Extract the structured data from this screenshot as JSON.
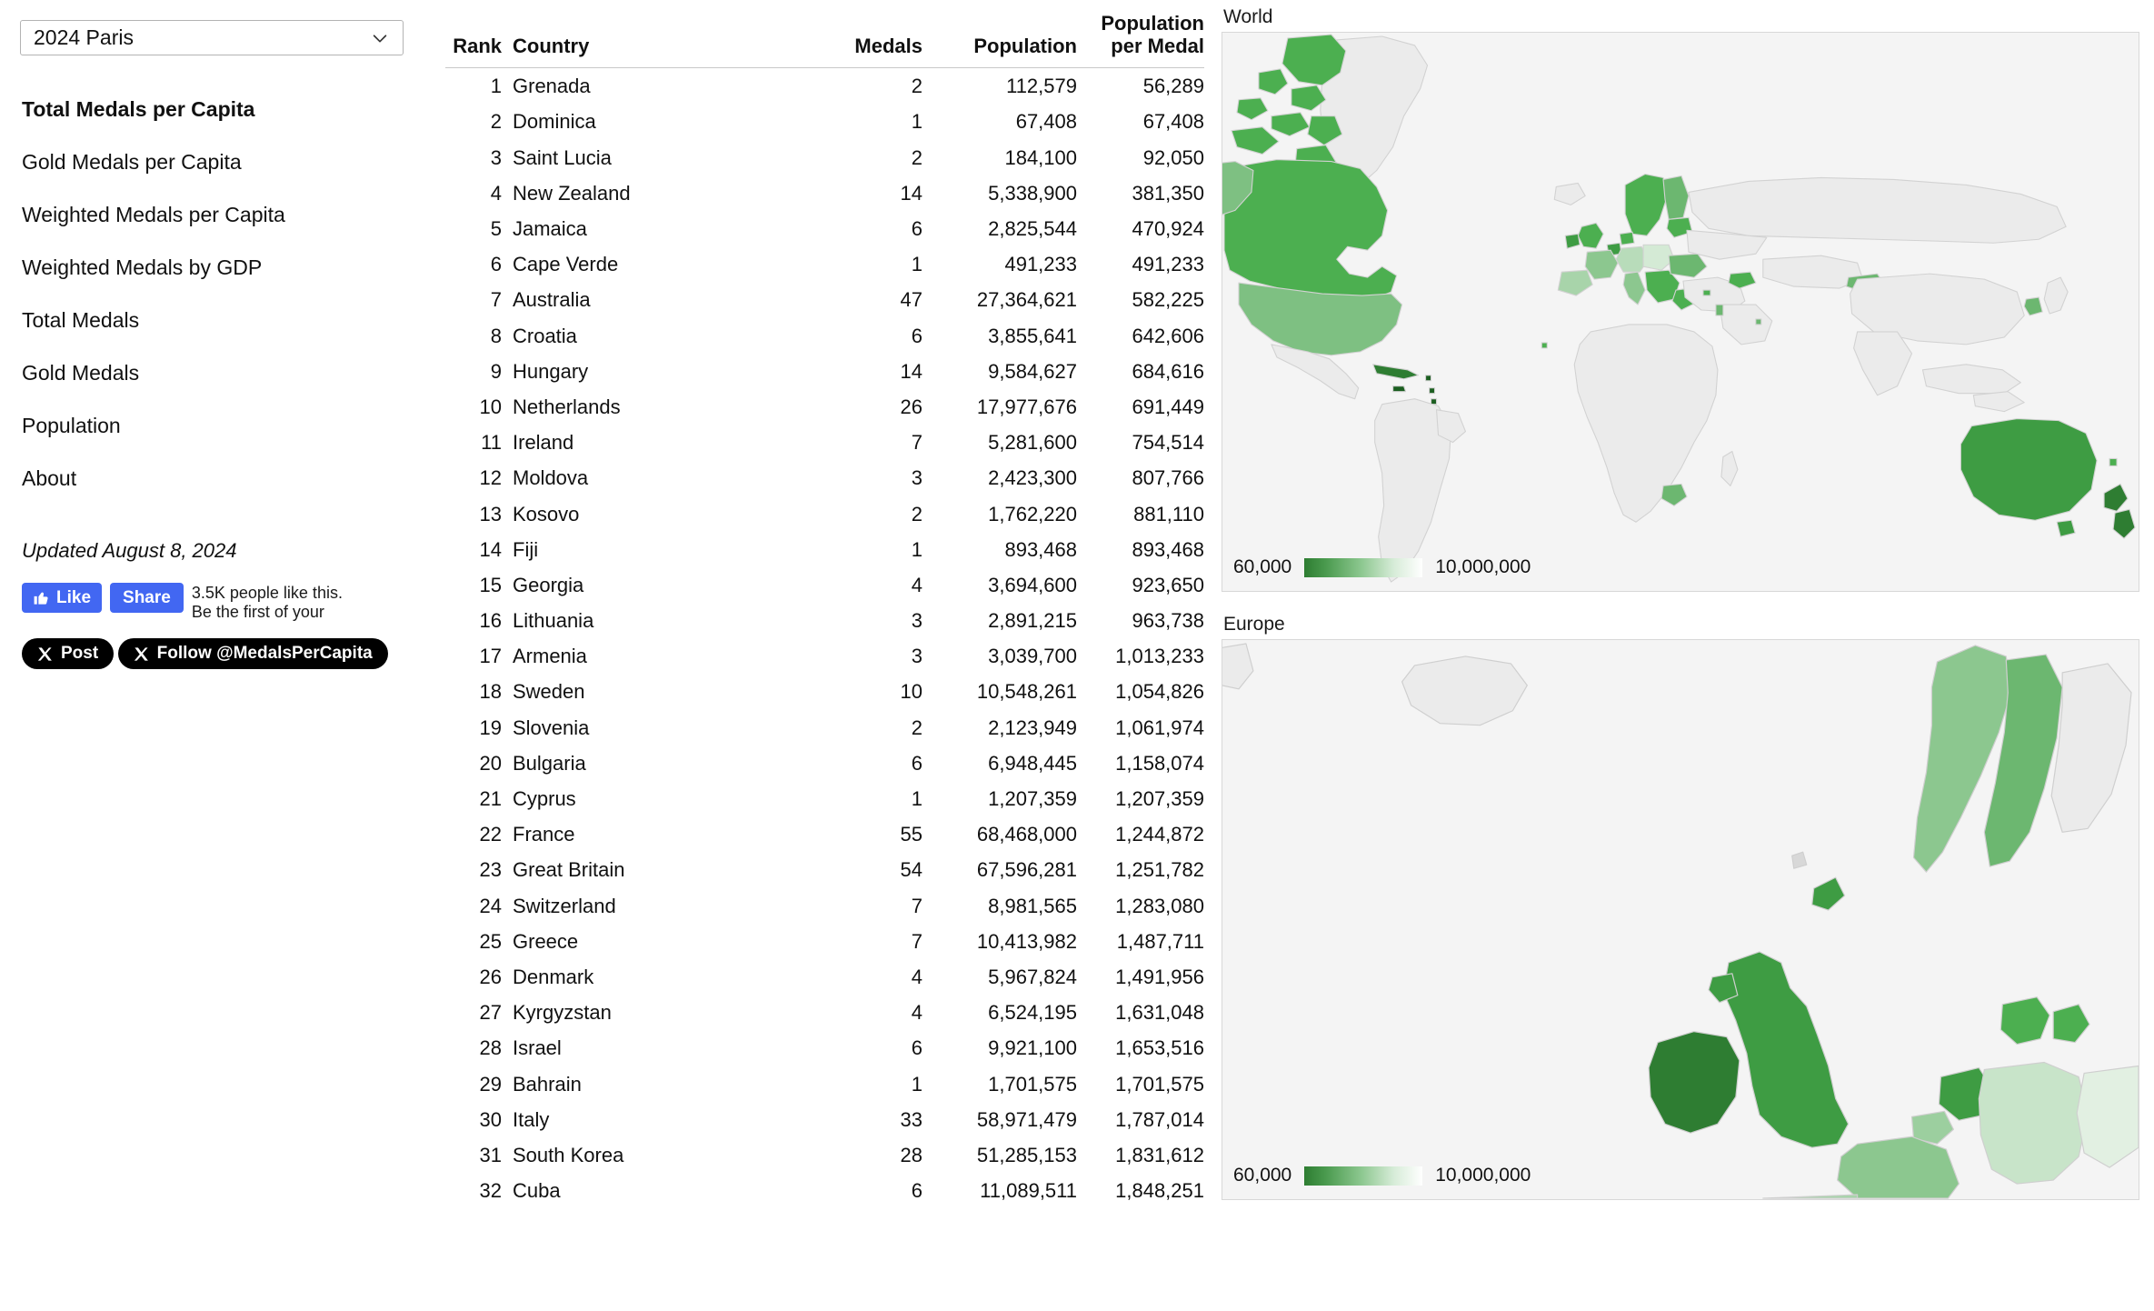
{
  "sidebar": {
    "games_select": {
      "value": "2024 Paris",
      "icon": "chevron-down-icon"
    },
    "nav_items": [
      {
        "label": "Total Medals per Capita",
        "active": true
      },
      {
        "label": "Gold Medals per Capita",
        "active": false
      },
      {
        "label": "Weighted Medals per Capita",
        "active": false
      },
      {
        "label": "Weighted Medals by GDP",
        "active": false
      },
      {
        "label": "Total Medals",
        "active": false
      },
      {
        "label": "Gold Medals",
        "active": false
      },
      {
        "label": "Population",
        "active": false
      },
      {
        "label": "About",
        "active": false
      }
    ],
    "updated": "Updated August 8, 2024",
    "facebook": {
      "like_label": "Like",
      "share_label": "Share",
      "like_icon": "thumbs-up-icon",
      "caption_line1": "3.5K people like this.",
      "caption_line2": "Be the first of your",
      "brand_color": "#4267f2"
    },
    "x_post": {
      "label": "Post",
      "icon": "x-logo-icon"
    },
    "x_follow": {
      "label": "Follow @MedalsPerCapita",
      "icon": "x-logo-icon"
    }
  },
  "table": {
    "columns": [
      "Rank",
      "Country",
      "Medals",
      "Population",
      "Population per Medal"
    ],
    "column_header_ppm_line1": "Population",
    "column_header_ppm_line2": "per Medal",
    "rows": [
      {
        "rank": "1",
        "country": "Grenada",
        "medals": "2",
        "population": "112,579",
        "per_medal": "56,289"
      },
      {
        "rank": "2",
        "country": "Dominica",
        "medals": "1",
        "population": "67,408",
        "per_medal": "67,408"
      },
      {
        "rank": "3",
        "country": "Saint Lucia",
        "medals": "2",
        "population": "184,100",
        "per_medal": "92,050"
      },
      {
        "rank": "4",
        "country": "New Zealand",
        "medals": "14",
        "population": "5,338,900",
        "per_medal": "381,350"
      },
      {
        "rank": "5",
        "country": "Jamaica",
        "medals": "6",
        "population": "2,825,544",
        "per_medal": "470,924"
      },
      {
        "rank": "6",
        "country": "Cape Verde",
        "medals": "1",
        "population": "491,233",
        "per_medal": "491,233"
      },
      {
        "rank": "7",
        "country": "Australia",
        "medals": "47",
        "population": "27,364,621",
        "per_medal": "582,225"
      },
      {
        "rank": "8",
        "country": "Croatia",
        "medals": "6",
        "population": "3,855,641",
        "per_medal": "642,606"
      },
      {
        "rank": "9",
        "country": "Hungary",
        "medals": "14",
        "population": "9,584,627",
        "per_medal": "684,616"
      },
      {
        "rank": "10",
        "country": "Netherlands",
        "medals": "26",
        "population": "17,977,676",
        "per_medal": "691,449"
      },
      {
        "rank": "11",
        "country": "Ireland",
        "medals": "7",
        "population": "5,281,600",
        "per_medal": "754,514"
      },
      {
        "rank": "12",
        "country": "Moldova",
        "medals": "3",
        "population": "2,423,300",
        "per_medal": "807,766"
      },
      {
        "rank": "13",
        "country": "Kosovo",
        "medals": "2",
        "population": "1,762,220",
        "per_medal": "881,110"
      },
      {
        "rank": "14",
        "country": "Fiji",
        "medals": "1",
        "population": "893,468",
        "per_medal": "893,468"
      },
      {
        "rank": "15",
        "country": "Georgia",
        "medals": "4",
        "population": "3,694,600",
        "per_medal": "923,650"
      },
      {
        "rank": "16",
        "country": "Lithuania",
        "medals": "3",
        "population": "2,891,215",
        "per_medal": "963,738"
      },
      {
        "rank": "17",
        "country": "Armenia",
        "medals": "3",
        "population": "3,039,700",
        "per_medal": "1,013,233"
      },
      {
        "rank": "18",
        "country": "Sweden",
        "medals": "10",
        "population": "10,548,261",
        "per_medal": "1,054,826"
      },
      {
        "rank": "19",
        "country": "Slovenia",
        "medals": "2",
        "population": "2,123,949",
        "per_medal": "1,061,974"
      },
      {
        "rank": "20",
        "country": "Bulgaria",
        "medals": "6",
        "population": "6,948,445",
        "per_medal": "1,158,074"
      },
      {
        "rank": "21",
        "country": "Cyprus",
        "medals": "1",
        "population": "1,207,359",
        "per_medal": "1,207,359"
      },
      {
        "rank": "22",
        "country": "France",
        "medals": "55",
        "population": "68,468,000",
        "per_medal": "1,244,872"
      },
      {
        "rank": "23",
        "country": "Great Britain",
        "medals": "54",
        "population": "67,596,281",
        "per_medal": "1,251,782"
      },
      {
        "rank": "24",
        "country": "Switzerland",
        "medals": "7",
        "population": "8,981,565",
        "per_medal": "1,283,080"
      },
      {
        "rank": "25",
        "country": "Greece",
        "medals": "7",
        "population": "10,413,982",
        "per_medal": "1,487,711"
      },
      {
        "rank": "26",
        "country": "Denmark",
        "medals": "4",
        "population": "5,967,824",
        "per_medal": "1,491,956"
      },
      {
        "rank": "27",
        "country": "Kyrgyzstan",
        "medals": "4",
        "population": "6,524,195",
        "per_medal": "1,631,048"
      },
      {
        "rank": "28",
        "country": "Israel",
        "medals": "6",
        "population": "9,921,100",
        "per_medal": "1,653,516"
      },
      {
        "rank": "29",
        "country": "Bahrain",
        "medals": "1",
        "population": "1,701,575",
        "per_medal": "1,701,575"
      },
      {
        "rank": "30",
        "country": "Italy",
        "medals": "33",
        "population": "58,971,479",
        "per_medal": "1,787,014"
      },
      {
        "rank": "31",
        "country": "South Korea",
        "medals": "28",
        "population": "51,285,153",
        "per_medal": "1,831,612"
      },
      {
        "rank": "32",
        "country": "Cuba",
        "medals": "6",
        "population": "11,089,511",
        "per_medal": "1,848,251"
      }
    ]
  },
  "maps": {
    "world": {
      "title": "World",
      "legend_min": "60,000",
      "legend_max": "10,000,000",
      "color_dark": "#2e7d32",
      "color_light": "#ffffff",
      "color_nodata": "#ebebeb"
    },
    "europe": {
      "title": "Europe",
      "legend_min": "60,000",
      "legend_max": "10,000,000",
      "color_dark": "#2e7d32",
      "color_light": "#ffffff",
      "color_nodata": "#ebebeb"
    }
  },
  "chart_data": {
    "type": "table",
    "title": "Total Medals per Capita — 2024 Paris",
    "columns": [
      "Rank",
      "Country",
      "Medals",
      "Population",
      "Population per Medal"
    ],
    "categories": [
      "Grenada",
      "Dominica",
      "Saint Lucia",
      "New Zealand",
      "Jamaica",
      "Cape Verde",
      "Australia",
      "Croatia",
      "Hungary",
      "Netherlands",
      "Ireland",
      "Moldova",
      "Kosovo",
      "Fiji",
      "Georgia",
      "Lithuania",
      "Armenia",
      "Sweden",
      "Slovenia",
      "Bulgaria",
      "Cyprus",
      "France",
      "Great Britain",
      "Switzerland",
      "Greece",
      "Denmark",
      "Kyrgyzstan",
      "Israel",
      "Bahrain",
      "Italy",
      "South Korea",
      "Cuba"
    ],
    "series": [
      {
        "name": "Medals",
        "values": [
          2,
          1,
          2,
          14,
          6,
          1,
          47,
          6,
          14,
          26,
          7,
          3,
          2,
          1,
          4,
          3,
          3,
          10,
          2,
          6,
          1,
          55,
          54,
          7,
          7,
          4,
          4,
          6,
          1,
          33,
          28,
          6
        ]
      },
      {
        "name": "Population",
        "values": [
          112579,
          67408,
          184100,
          5338900,
          2825544,
          491233,
          27364621,
          3855641,
          9584627,
          17977676,
          5281600,
          2423300,
          1762220,
          893468,
          3694600,
          2891215,
          3039700,
          10548261,
          2123949,
          6948445,
          1207359,
          68468000,
          67596281,
          8981565,
          10413982,
          5967824,
          6524195,
          9921100,
          1701575,
          58971479,
          51285153,
          11089511
        ]
      },
      {
        "name": "Population per Medal",
        "values": [
          56289,
          67408,
          92050,
          381350,
          470924,
          491233,
          582225,
          642606,
          684616,
          691449,
          754514,
          807766,
          881110,
          893468,
          923650,
          963738,
          1013233,
          1054826,
          1061974,
          1158074,
          1207359,
          1244872,
          1251782,
          1283080,
          1487711,
          1491956,
          1631048,
          1653516,
          1701575,
          1787014,
          1831612,
          1848251
        ]
      }
    ],
    "xlabel": "Country",
    "ylabel": "Population per Medal",
    "legend_scale": {
      "min": 60000,
      "max": 10000000,
      "colormap": "green-to-white"
    }
  }
}
